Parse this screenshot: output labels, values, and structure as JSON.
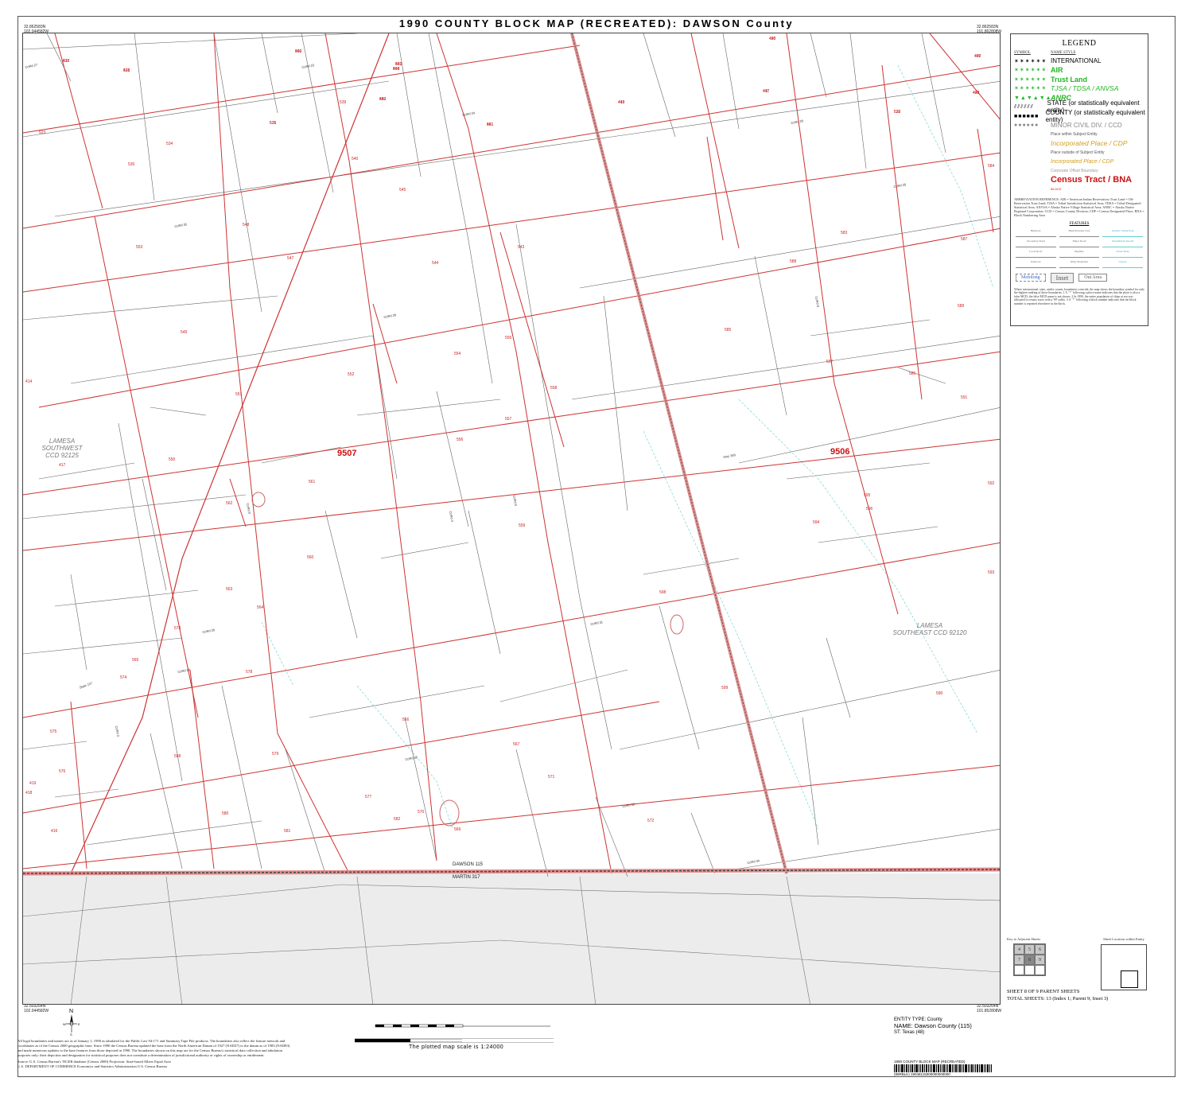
{
  "title": "1990 COUNTY BLOCK MAP (RECREATED): DAWSON County",
  "corners": {
    "tl": "32.862583N\n102.044582W",
    "tr": "32.862583N\n101.862808W",
    "bl": "32.503264N\n102.044582W",
    "br": "32.503264N\n101.852808W"
  },
  "tracts": [
    {
      "label": "9507"
    },
    {
      "label": "9506"
    }
  ],
  "ccd_labels": [
    {
      "text": "LAMESA\nSOUTHWEST\nCCD 92125"
    },
    {
      "text": "LAMESA\nSOUTHEAST CCD 92120"
    }
  ],
  "county_boundary": {
    "north_label": "DAWSON 115",
    "south_label": "MARTIN 317"
  },
  "blocks": [
    "537",
    "538",
    "502",
    "501",
    "503",
    "420",
    "407",
    "411",
    "422",
    "413",
    "542",
    "541",
    "520",
    "535",
    "534",
    "530",
    "523",
    "539",
    "540",
    "544",
    "545",
    "548",
    "543",
    "553",
    "547",
    "549",
    "552",
    "551",
    "550",
    "554",
    "555",
    "557",
    "558",
    "556",
    "559",
    "560",
    "561",
    "562",
    "563",
    "564",
    "565",
    "566",
    "567",
    "568",
    "569",
    "570",
    "571",
    "572",
    "573",
    "574",
    "575",
    "576",
    "577",
    "578",
    "579",
    "580",
    "581",
    "582",
    "583",
    "584",
    "585",
    "586",
    "587",
    "588",
    "589",
    "590",
    "591",
    "592",
    "593",
    "594",
    "595",
    "596",
    "597",
    "598",
    "599",
    "416",
    "418",
    "419",
    "414",
    "417",
    "415",
    "421",
    "440",
    "443",
    "444",
    "445",
    "446",
    "447",
    "448",
    "449",
    "450",
    "451",
    "532",
    "531"
  ],
  "roads": [
    "CoRd 27",
    "CoRd 24",
    "CoRd 23",
    "CoRd 20",
    "CoRd 26",
    "CoRd 28",
    "CoRd 29",
    "CoRd 30",
    "CoRd 31",
    "CoRd 32",
    "CoRd 33",
    "CoRd 34",
    "CoRd 35",
    "Hwy 349",
    "State 137",
    "CoRd 9",
    "CoRd 4",
    "CoRd 5",
    "CoRd 8",
    "CoRd 3"
  ],
  "legend": {
    "title": "LEGEND",
    "col_symbol": "SYMBOL",
    "col_name": "NAME STYLE",
    "items": [
      {
        "sym": "✶✶✶✶✶✶",
        "name": "INTERNATIONAL",
        "color": "#000000",
        "style": "normal"
      },
      {
        "sym": "✶✶✶✶✶✶",
        "name": "AIR",
        "color": "#22b522",
        "style": "bold"
      },
      {
        "sym": "✶✶✶✶✶✶",
        "name": "Trust Land",
        "color": "#22b522",
        "style": "bold"
      },
      {
        "sym": "✶✶✶✶✶✶",
        "name": "TJSA / TDSA / ANVSA",
        "color": "#22b522",
        "style": "italic"
      },
      {
        "sym": "▼▲▼▲▼▲",
        "name": "ANRC",
        "color": "#22b522",
        "style": "bolditalic"
      },
      {
        "sym": "⫽⫽⫽⫽⫽⫽",
        "name": "STATE (or statistically equivalent entity)",
        "color": "#000000",
        "style": "normal"
      },
      {
        "sym": "■■■■■■",
        "name": "COUNTY (or statistically equivalent entity)",
        "color": "#000000",
        "style": "normal"
      },
      {
        "sym": "●●●●●●",
        "name": "MINOR CIVIL DIV. / CCD",
        "color": "#888888",
        "style": "normal"
      },
      {
        "sym": "",
        "name": "Place within Subject Entity",
        "color": "#555555",
        "style": "small"
      },
      {
        "sym": "",
        "name": "Incorporated Place / CDP",
        "color": "#d4a020",
        "style": "italic"
      },
      {
        "sym": "",
        "name": "Place outside of Subject Entity",
        "color": "#555555",
        "style": "small"
      },
      {
        "sym": "",
        "name": "Incorporated Place / CDP",
        "color": "#d4a020",
        "style": "italic-small"
      },
      {
        "sym": "",
        "name": "Corporate Offset Boundary",
        "color": "#999999",
        "style": "small"
      },
      {
        "sym": "",
        "name": "Census Tract / BNA",
        "color": "#cc1111",
        "style": "big"
      },
      {
        "sym": "",
        "name": "BLOCK",
        "color": "#cc1111",
        "style": "tiny"
      }
    ],
    "abbreviation": "ABBREVIATION REFERENCE: AIR = American Indian Reservation; Trust Land = Off-Reservation Trust Land; TJSA = Tribal Jurisdiction Statistical Area; TDSA = Tribal Designated Statistical Area; ANVSA = Alaska Native Village Statistical Area; ANRC = Alaska Native Regional Corporation; CCD = Census County Division; CDP = Census Designated Place; BNA = Block Numbering Area",
    "features_title": "FEATURES",
    "features": [
      "Highway",
      "High Pressure Line",
      "Stream / Waterbody",
      "Secondary Road",
      "Major Road",
      "Intermittent Stream",
      "Local Road",
      "Pipeline",
      "Water Body",
      "Railroad",
      "Other Boundary",
      "Glacier"
    ],
    "inset_labels": [
      "Mobilong",
      "Inset",
      "Out Area"
    ],
    "notes": "Where international, state, and/or county boundaries coincide, the map shows the boundary symbol for only the highest-ranking of these boundaries. 1 A ' * ' following a place name indicates that the place is also a false MCD; the false MCD name is not shown. 2 In 1990, the entire population of ships at sea was allocated to census tracts with a '99' suffix. 3 A ' * ' following a block number indicates that the block number is repeated elsewhere in the block."
  },
  "key": {
    "title": "Key to Adjacent Sheets",
    "cells": [
      "4",
      "5",
      "6",
      "7",
      "8",
      "9",
      "",
      "",
      ""
    ],
    "current": "8"
  },
  "location": {
    "title": "Sheet Location within Entity"
  },
  "sheet_info": {
    "line1": "SHEET 8 OF 9 PARENT SHEETS",
    "line2": "TOTAL SHEETS: 13 (Index 1; Parent 9; Inset 3)"
  },
  "entity": {
    "type": "ENTITY TYPE: County",
    "name": "NAME: Dawson County (115)",
    "st": "ST: Texas (48)"
  },
  "scale_text": "The plotted map scale is 1:24000",
  "disclaimer": "All legal boundaries and names are as of January 1, 1990 as tabulated for the Public Law 94-171 and Summary Tape File products. The boundaries also reflect the feature network and coordinates as of the Census 2000 geographic base. Since 1990 the Census Bureau updated the base from the North American Datum of 1927 (NAD27) to the datum as of 1983 (NAD83) and made numerous updates to the base features from those depicted in 1990. The boundaries shown on this map are for the Census Bureau's statistical data collection and tabulation purposes only; their depiction and designation for statistical purposes does not constitute a determination of jurisdictional authority or rights of ownership or entitlement.",
  "source": "Source: U.S. Census Bureau's TIGER database (Census 2000)          Projection: State-based Albers Equal Area",
  "agency": "U.S. DEPARTMENT OF COMMERCE Economics and Statistics Administration  U.S. Census Bureau",
  "barcode": {
    "label": "1990 COUNTY BLOCK MAP (RECREATED)",
    "code": "(99RBLK) 19048115000000000000"
  },
  "colors": {
    "tract": "#cc3333",
    "road": "#555555",
    "stream": "#66cccc",
    "county_fill": "#ececec",
    "block_label": "#cc2222"
  }
}
